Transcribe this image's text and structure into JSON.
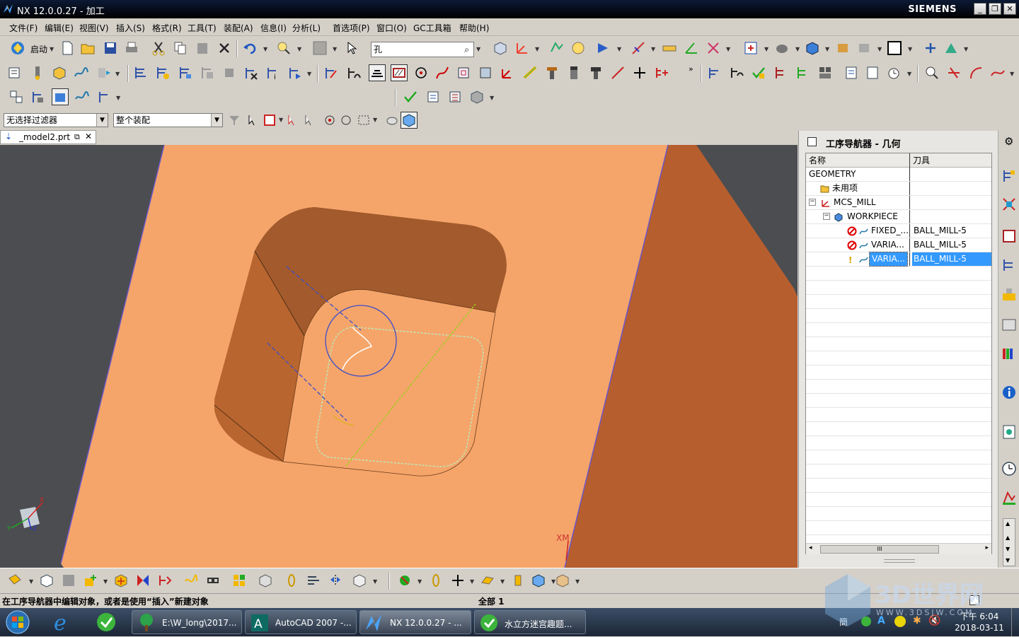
{
  "window": {
    "title": "NX 12.0.0.27 - 加工",
    "brand": "SIEMENS"
  },
  "menu": [
    "文件(F)",
    "编辑(E)",
    "视图(V)",
    "插入(S)",
    "格式(R)",
    "工具(T)",
    "装配(A)",
    "信息(I)",
    "分析(L)",
    "首选项(P)",
    "窗口(O)",
    "GC工具箱",
    "帮助(H)"
  ],
  "toolbar": {
    "start_label": "启动",
    "command_search_value": "孔"
  },
  "selection_bar": {
    "filter_value": "无选择过滤器",
    "scope_value": "整个装配"
  },
  "doc_tab": {
    "label": "_model2.prt"
  },
  "viewport": {
    "axis_label": "XM",
    "triad_x": "X",
    "triad_y": "Y",
    "triad_z": "Z"
  },
  "navigator": {
    "title": "工序导航器 - 几何",
    "col_name": "名称",
    "col_tool": "刀具",
    "rows": [
      {
        "name": "GEOMETRY",
        "tool": ""
      },
      {
        "name": "未用项",
        "tool": ""
      },
      {
        "name": "MCS_MILL",
        "tool": ""
      },
      {
        "name": "WORKPIECE",
        "tool": ""
      },
      {
        "name": "FIXED_...",
        "tool": "BALL_MILL-5"
      },
      {
        "name": "VARIA...",
        "tool": "BALL_MILL-5"
      },
      {
        "name": "VARIA...",
        "tool": "BALL_MILL-5"
      }
    ],
    "scroll_grip": "III"
  },
  "status": {
    "message": "在工序导航器中编辑对象，或者是使用“插入”新建对象",
    "scope": "全部 1"
  },
  "taskbar": {
    "items": [
      "E:\\W_long\\2017...",
      "AutoCAD 2007 -...",
      "NX 12.0.0.27 - ...",
      "水立方迷宫趣题..."
    ],
    "time": "下午 6:04",
    "date": "2018-03-11"
  },
  "watermark": {
    "text": "3D世界网",
    "url": "WWW.3DSJW.COM"
  },
  "colors": {
    "part": "#f5a56a",
    "part_dark": "#b75e2f",
    "viewport_bg": "#4b4d50",
    "selected_row": "#3399ff"
  }
}
